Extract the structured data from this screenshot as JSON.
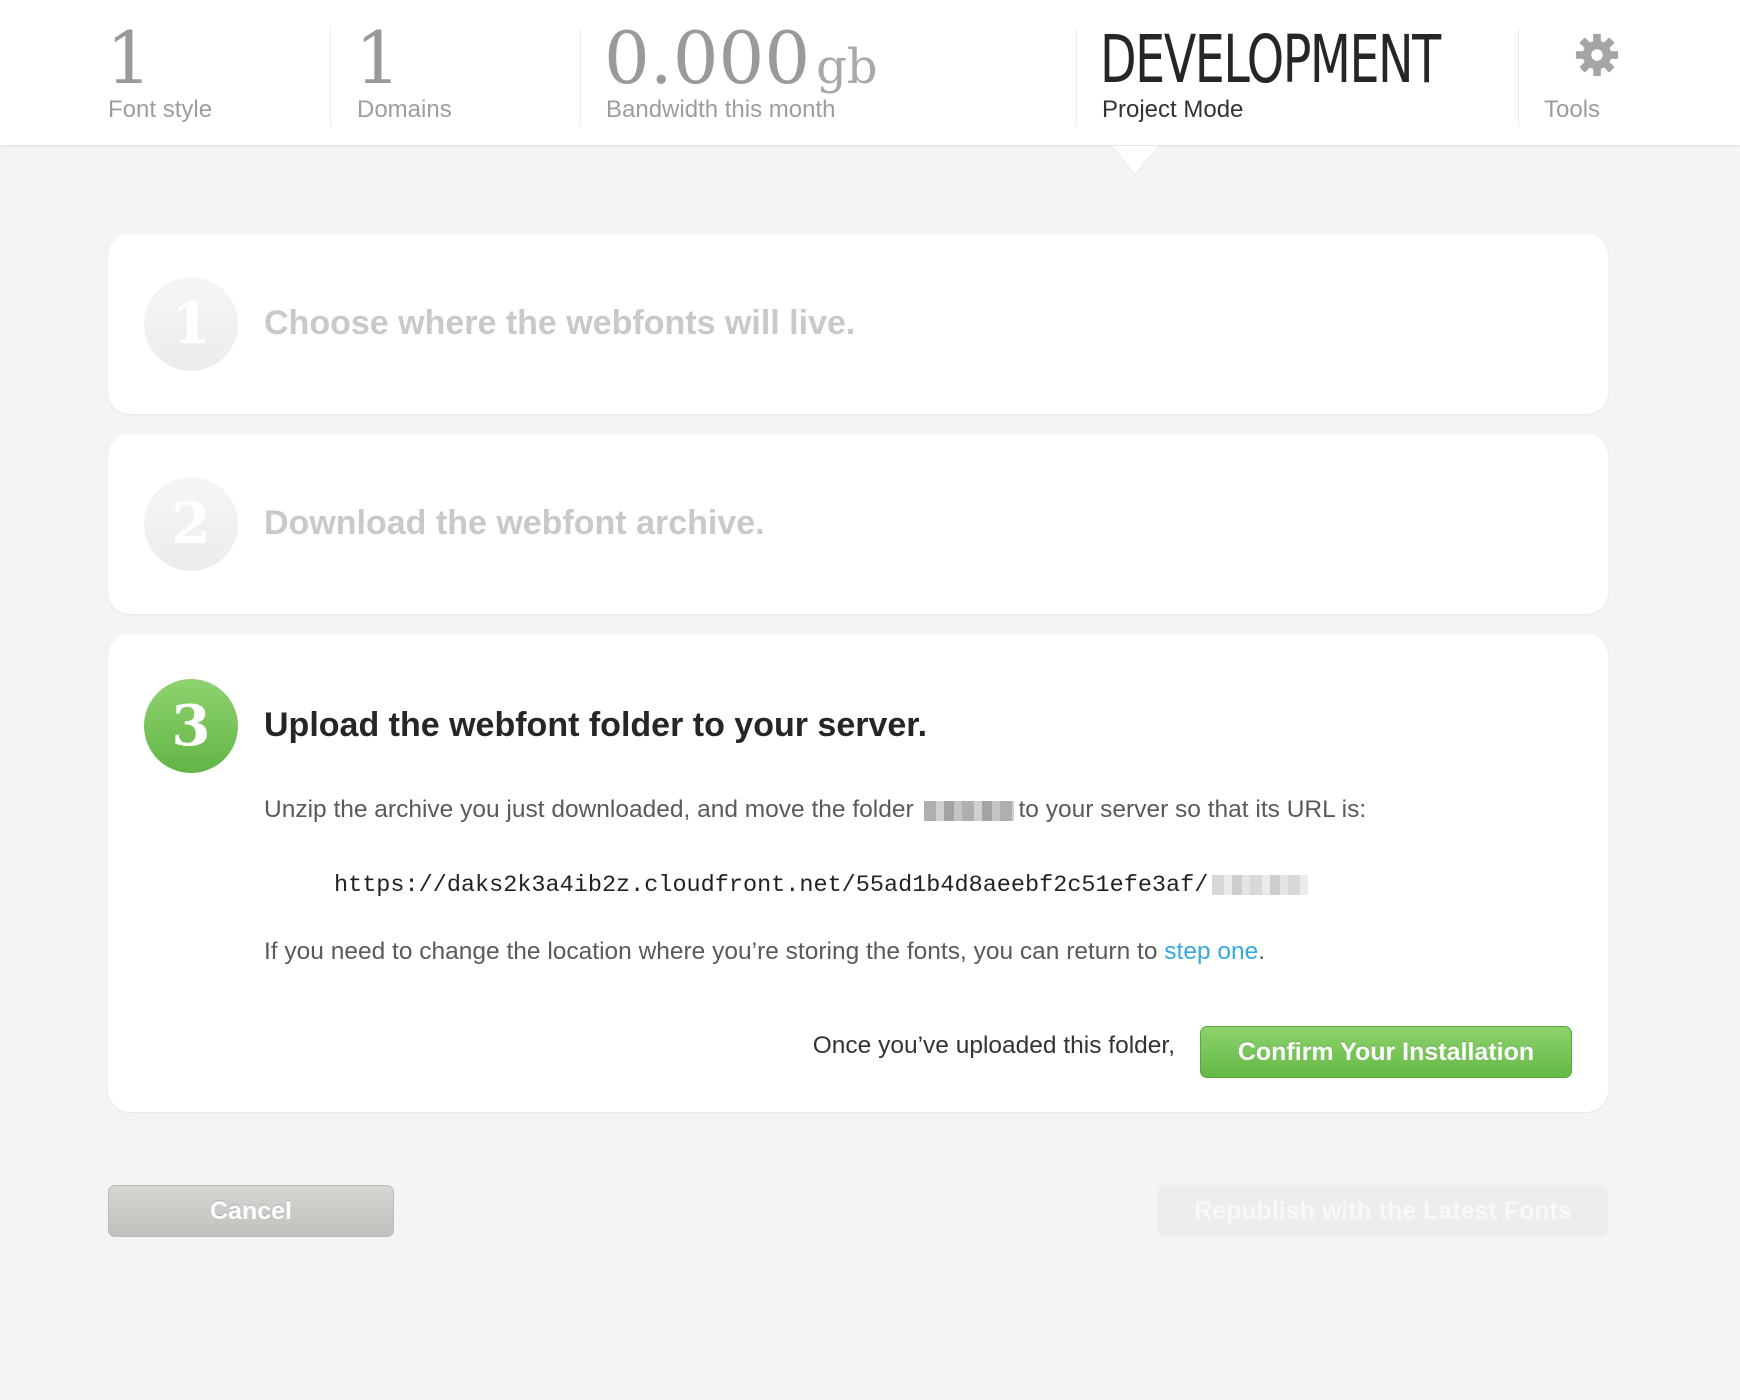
{
  "stats": {
    "font_style": {
      "value": "1",
      "label": "Font style"
    },
    "domains": {
      "value": "1",
      "label": "Domains"
    },
    "bandwidth": {
      "value": "0.000",
      "unit": "gb",
      "label": "Bandwidth this month"
    },
    "project_mode": {
      "value": "DEVELOPMENT",
      "label": "Project Mode"
    },
    "tools": {
      "label": "Tools",
      "icon": "gear-icon"
    }
  },
  "steps": [
    {
      "number": "1",
      "title": "Choose where the webfonts will live.",
      "state": "inactive"
    },
    {
      "number": "2",
      "title": "Download the webfont archive.",
      "state": "inactive"
    },
    {
      "number": "3",
      "title": "Upload the webfont folder to your server.",
      "state": "active",
      "instruction_before": "Unzip the archive you just downloaded, and move the folder",
      "instruction_after": "to your server so that its URL is:",
      "url": "https://daks2k3a4ib2z.cloudfront.net/55ad1b4d8aeebf2c51efe3af/",
      "change_text": "If you need to change the location where you’re storing the fonts, you can return to",
      "change_link": "step one",
      "change_end": ".",
      "confirm_prompt": "Once you’ve uploaded this folder,",
      "confirm_button": "Confirm Your Installation"
    }
  ],
  "actions": {
    "cancel": "Cancel",
    "republish": "Republish with the Latest Fonts"
  },
  "colors": {
    "accent_green": "#6cbf4d",
    "link_blue": "#35a9e1",
    "background": "#f4f4f4"
  }
}
